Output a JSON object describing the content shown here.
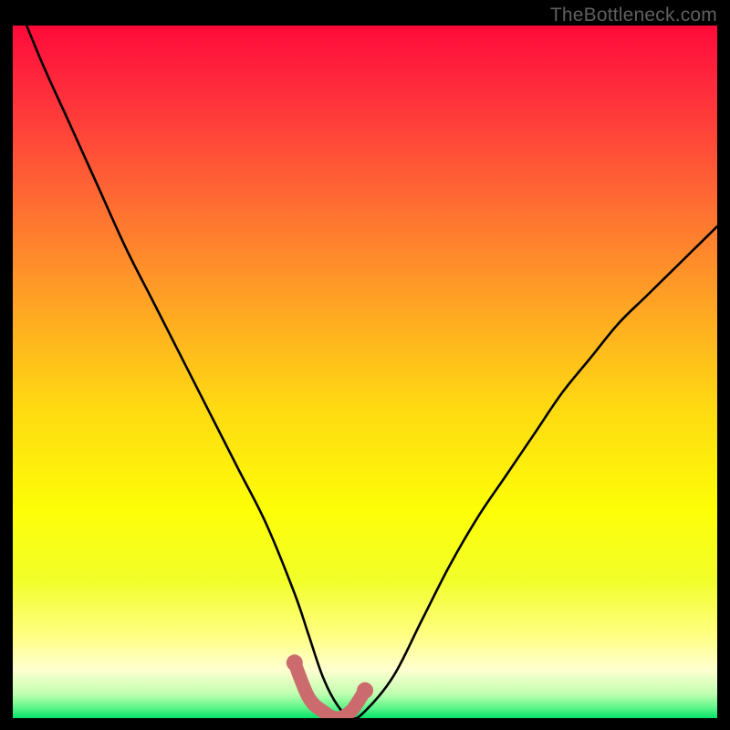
{
  "watermark": "TheBottleneck.com",
  "chart_data": {
    "type": "line",
    "title": "",
    "xlabel": "",
    "ylabel": "",
    "xlim": [
      0,
      100
    ],
    "ylim": [
      0,
      100
    ],
    "series": [
      {
        "name": "bottleneck-curve",
        "x": [
          0,
          4,
          8,
          12,
          16,
          20,
          24,
          28,
          32,
          36,
          40,
          42,
          44,
          46,
          48,
          50,
          54,
          58,
          62,
          66,
          70,
          74,
          78,
          82,
          86,
          90,
          94,
          98,
          100
        ],
        "values": [
          105,
          95,
          86,
          77,
          68,
          60,
          52,
          44,
          36,
          28,
          18,
          12,
          6,
          2,
          0,
          1,
          6,
          14,
          22,
          29,
          35,
          41,
          47,
          52,
          57,
          61,
          65,
          69,
          71
        ]
      },
      {
        "name": "highlight-segment",
        "x": [
          40,
          42,
          44,
          46,
          48,
          50
        ],
        "values": [
          8,
          3,
          1,
          0,
          1,
          4
        ]
      }
    ],
    "gradient_stops": [
      {
        "offset": 0.0,
        "color": "#ff0a3a"
      },
      {
        "offset": 0.1,
        "color": "#ff2f3c"
      },
      {
        "offset": 0.25,
        "color": "#ff6a33"
      },
      {
        "offset": 0.4,
        "color": "#ffa324"
      },
      {
        "offset": 0.55,
        "color": "#ffd912"
      },
      {
        "offset": 0.7,
        "color": "#fdfe07"
      },
      {
        "offset": 0.8,
        "color": "#f2fe29"
      },
      {
        "offset": 0.88,
        "color": "#ffff82"
      },
      {
        "offset": 0.93,
        "color": "#ffffd1"
      },
      {
        "offset": 0.965,
        "color": "#c0ffb0"
      },
      {
        "offset": 0.985,
        "color": "#5ef589"
      },
      {
        "offset": 1.0,
        "color": "#06e26a"
      }
    ],
    "highlight_color": "#cc6b6e",
    "curve_color": "#000000"
  }
}
